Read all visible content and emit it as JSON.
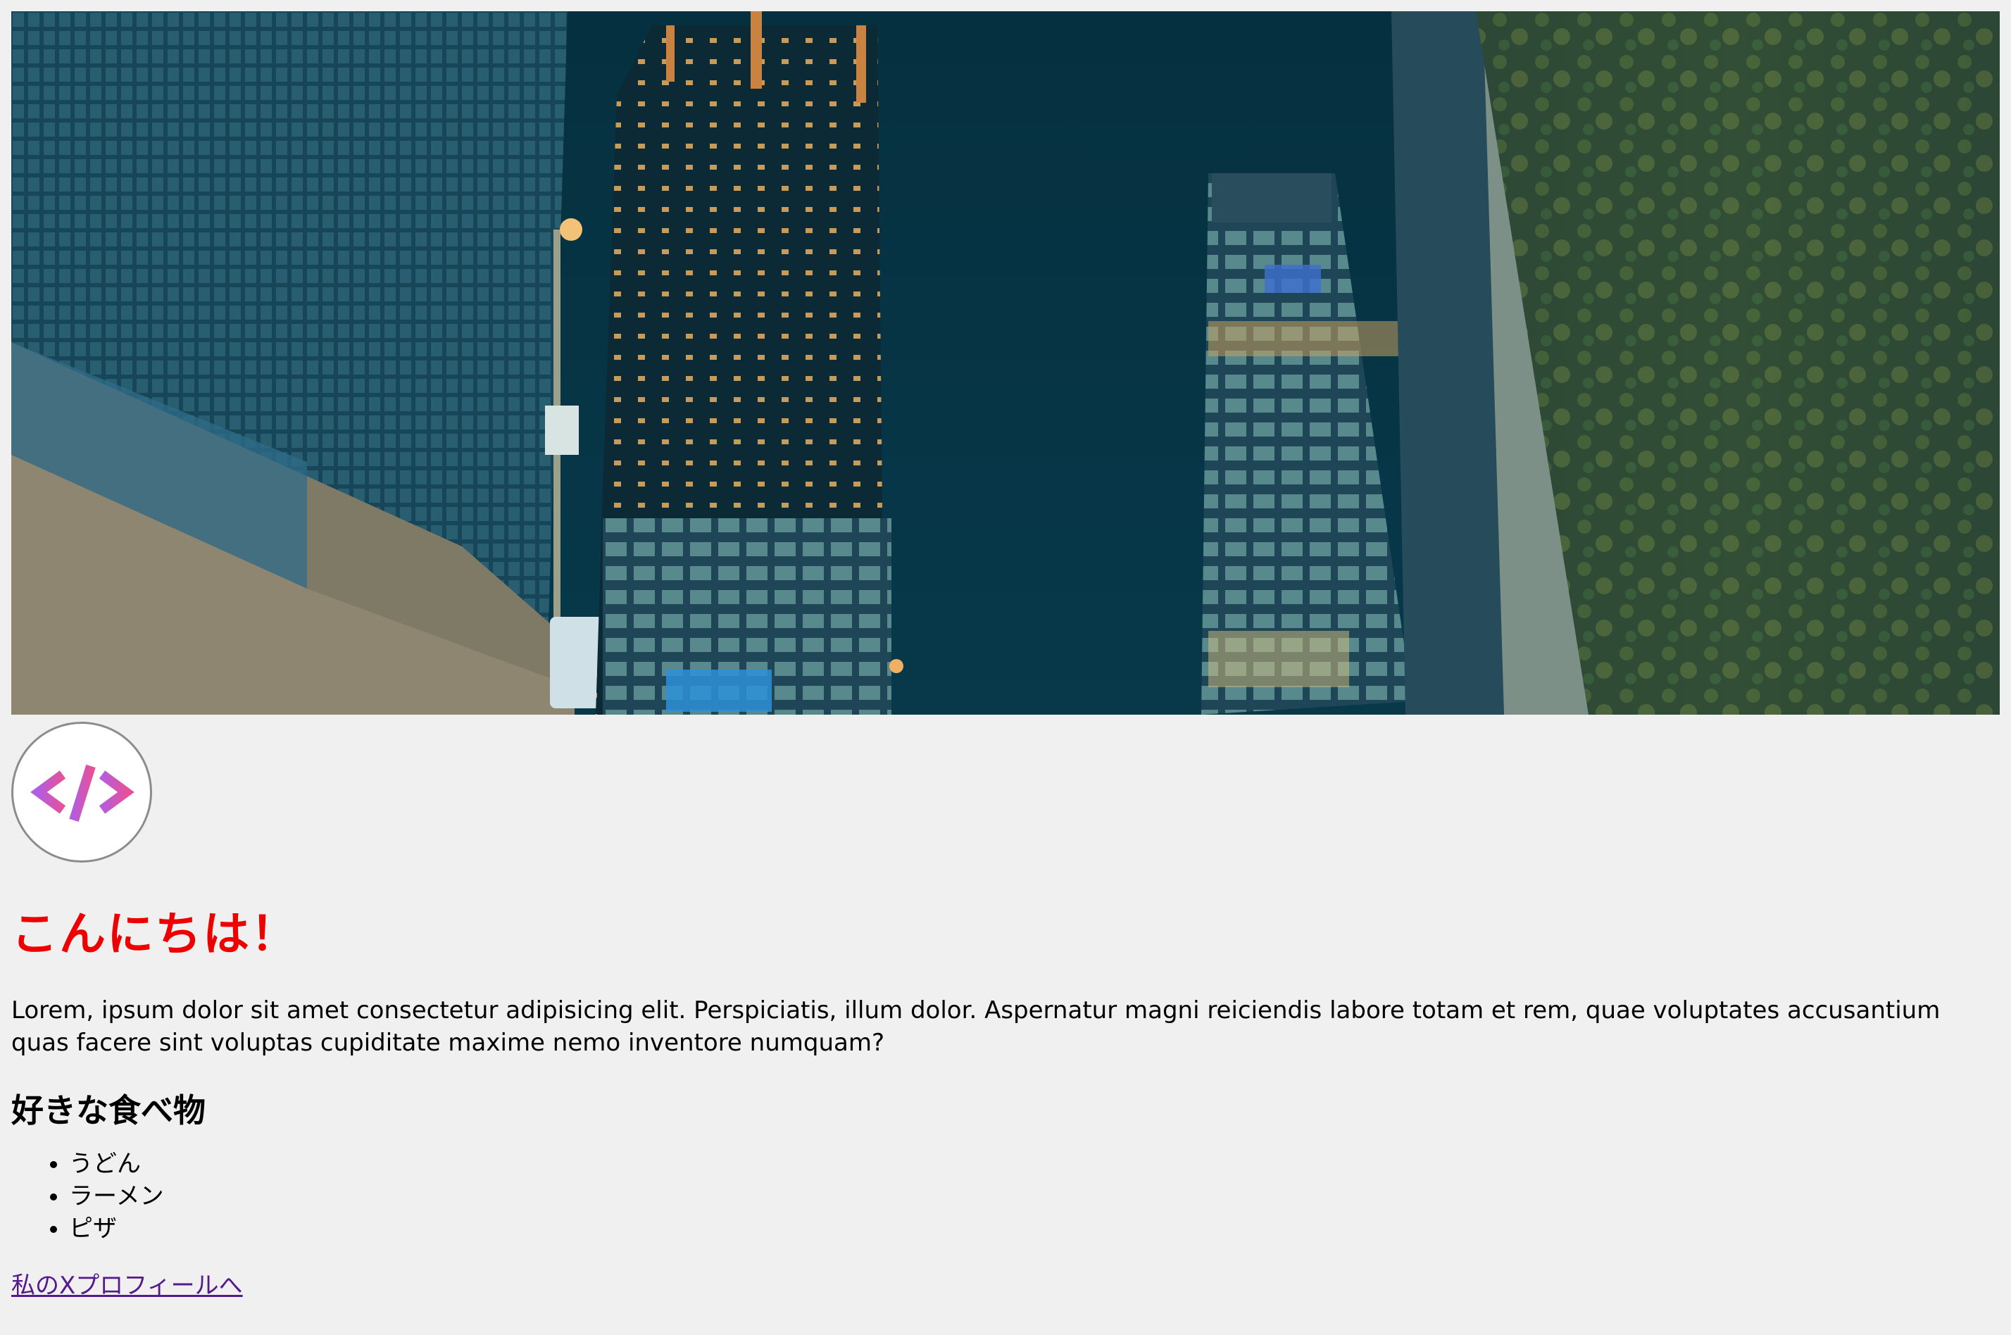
{
  "hero": {
    "icon": "city-night-photo"
  },
  "avatar": {
    "icon": "code-brackets-icon",
    "glyph": "</>"
  },
  "content": {
    "title": "こんにちは！",
    "intro": "Lorem, ipsum dolor sit amet consectetur adipisicing elit. Perspiciatis, illum dolor. Aspernatur magni reiciendis labore totam et rem, quae voluptates accusantium quas facere sint voluptas cupiditate maxime nemo inventore numquam?",
    "food_heading": "好きな食べ物",
    "foods": [
      "うどん",
      "ラーメン",
      "ピザ"
    ],
    "profile_link": "私のXプロフィールへ"
  },
  "colors": {
    "background": "#f0f0f0",
    "title": "#ee0000",
    "link_visited": "#551a8b",
    "avatar_gradient_start": "#b45ce0",
    "avatar_gradient_end": "#e6529a"
  }
}
